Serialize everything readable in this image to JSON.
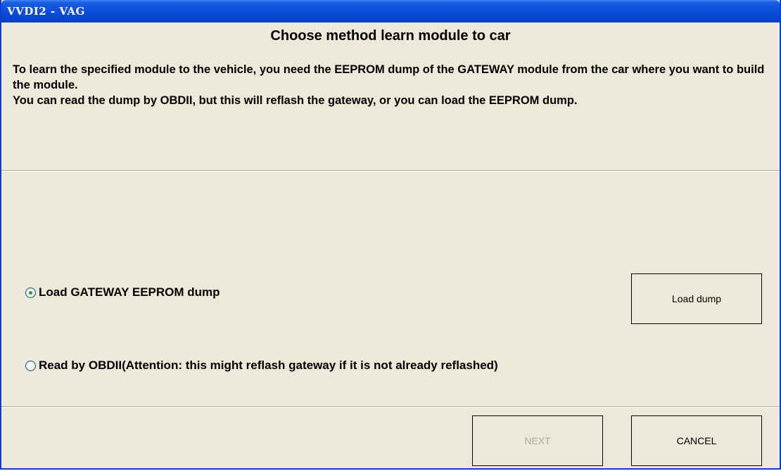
{
  "window": {
    "title": "VVDI2 - VAG"
  },
  "header": {
    "heading": "Choose method learn module to car",
    "description_line1": "To learn the specified module to the vehicle, you need the EEPROM dump of the GATEWAY module from the car where you want to build the module.",
    "description_line2": "You can read the  dump by OBDII, but this will reflash the gateway, or you can load the EEPROM dump."
  },
  "options": {
    "load_label": "Load GATEWAY EEPROM dump",
    "load_selected": true,
    "obd_label": "Read by OBDII(Attention: this might reflash gateway if it is not already reflashed)",
    "obd_selected": false
  },
  "buttons": {
    "load_dump": "Load dump",
    "next": "NEXT",
    "next_enabled": false,
    "cancel": "CANCEL"
  },
  "colors": {
    "titlebar": "#0a4fdb",
    "dialog_bg": "#ece9d8",
    "radio_dot": "#21a121",
    "disabled_text": "#aca899"
  }
}
